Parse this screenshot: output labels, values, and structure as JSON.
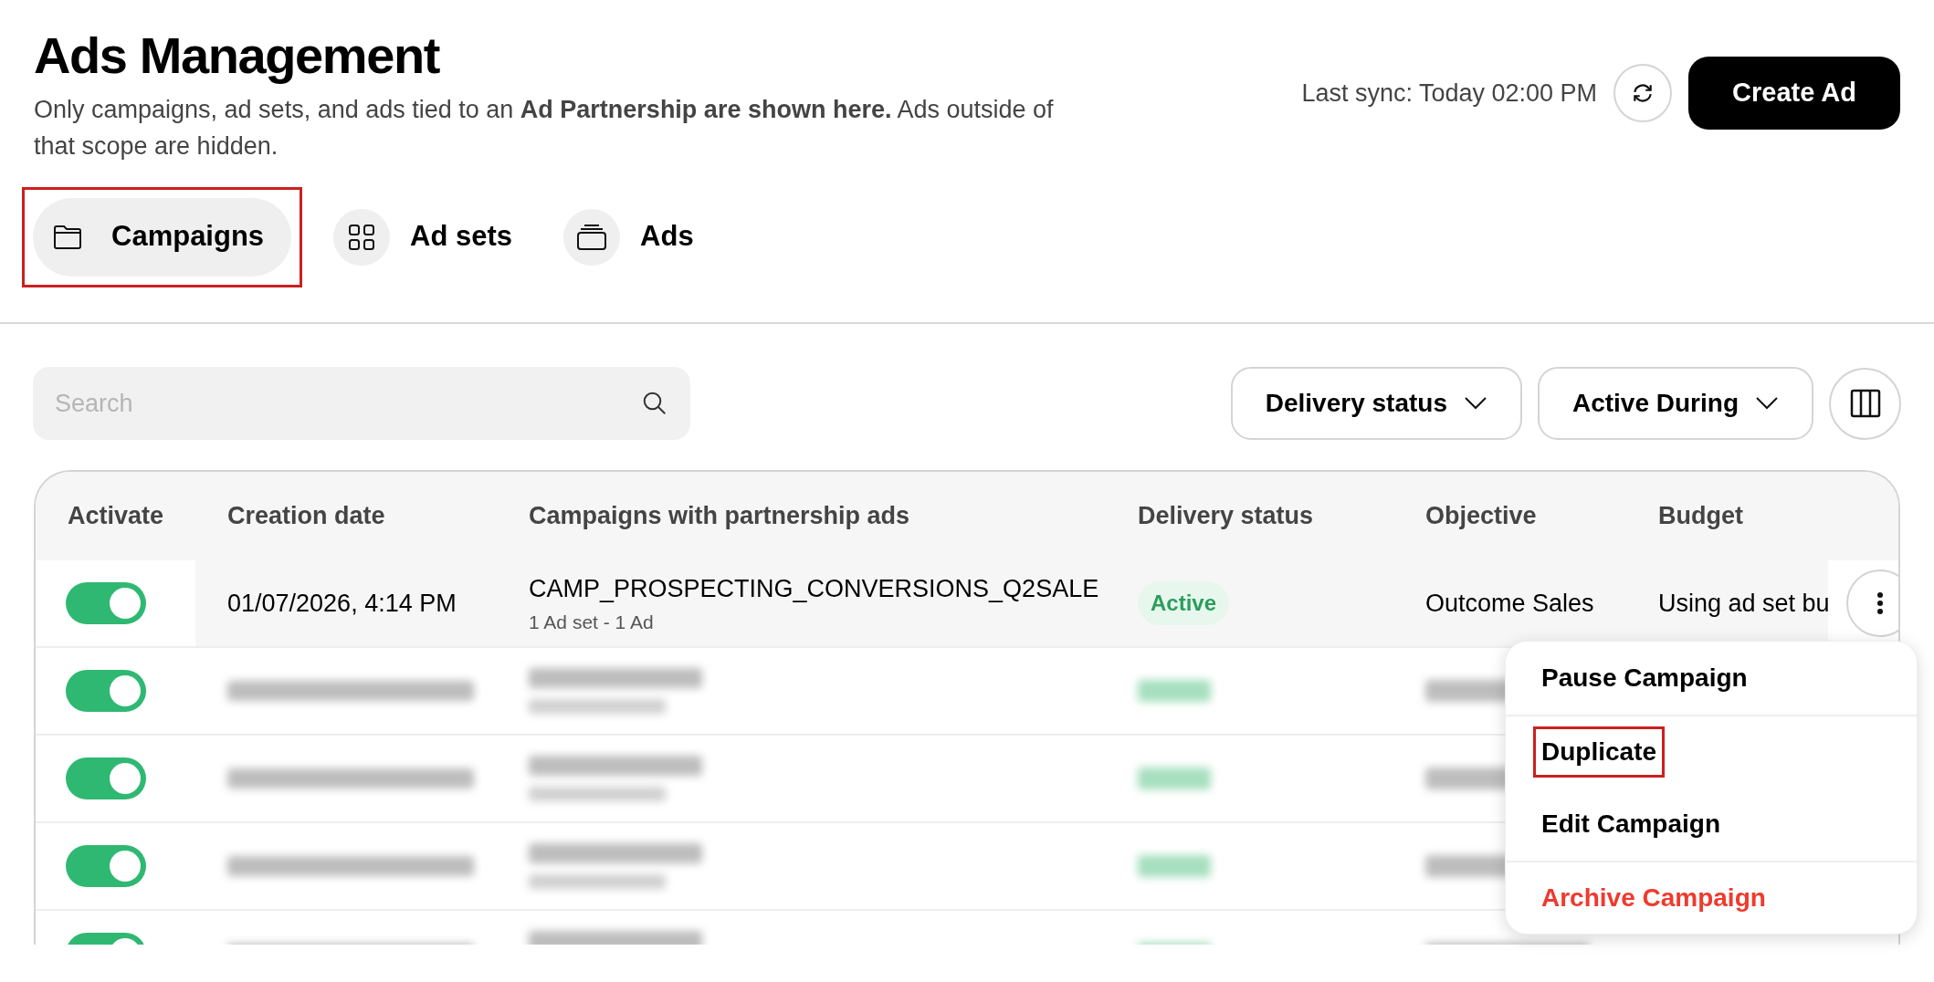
{
  "header": {
    "title": "Ads Management",
    "description": "Only campaigns, ad sets, and ads tied to an **Ad Partnership are shown here.** Ads outside of that scope are hidden.",
    "last_sync": "Last sync: Today 02:00 PM",
    "create_button": "Create Ad"
  },
  "tabs": [
    {
      "label": "Campaigns",
      "kind": "folder",
      "selected": true,
      "highlighted": true
    },
    {
      "label": "Ad sets",
      "kind": "grid",
      "selected": false,
      "highlighted": false
    },
    {
      "label": "Ads",
      "kind": "stack",
      "selected": false,
      "highlighted": false
    }
  ],
  "search": {
    "placeholder": "Search"
  },
  "filters": [
    "Delivery status",
    "Active During"
  ],
  "table": {
    "columns": [
      "Activate",
      "Creation date",
      "Campaigns with partnership ads",
      "Delivery status",
      "Objective",
      "Budget"
    ],
    "rows": [
      {
        "kind": "plain",
        "active": true,
        "created": "01/07/2026, 4:14 PM",
        "name": "CAMP_PROSPECTING_CONVERSIONS_Q2SALE",
        "counts": "1 Ad set - 1 Ad",
        "status": "Active",
        "objective": "Outcome Sales",
        "budget": "Using ad set bu"
      },
      {
        "kind": "blurred",
        "active": true
      },
      {
        "kind": "blurred",
        "active": true
      },
      {
        "kind": "blurred",
        "active": true
      },
      {
        "kind": "blurred",
        "active": true
      }
    ]
  },
  "menu": {
    "items": [
      {
        "label": "Pause Campaign",
        "kind": "normal",
        "separator_before": false,
        "highlighted": false
      },
      {
        "label": "Duplicate",
        "kind": "normal",
        "separator_before": true,
        "highlighted": true
      },
      {
        "label": "Edit Campaign",
        "kind": "normal",
        "separator_before": false,
        "highlighted": false
      },
      {
        "label": "Archive Campaign",
        "kind": "danger",
        "separator_before": true,
        "highlighted": false
      }
    ]
  }
}
